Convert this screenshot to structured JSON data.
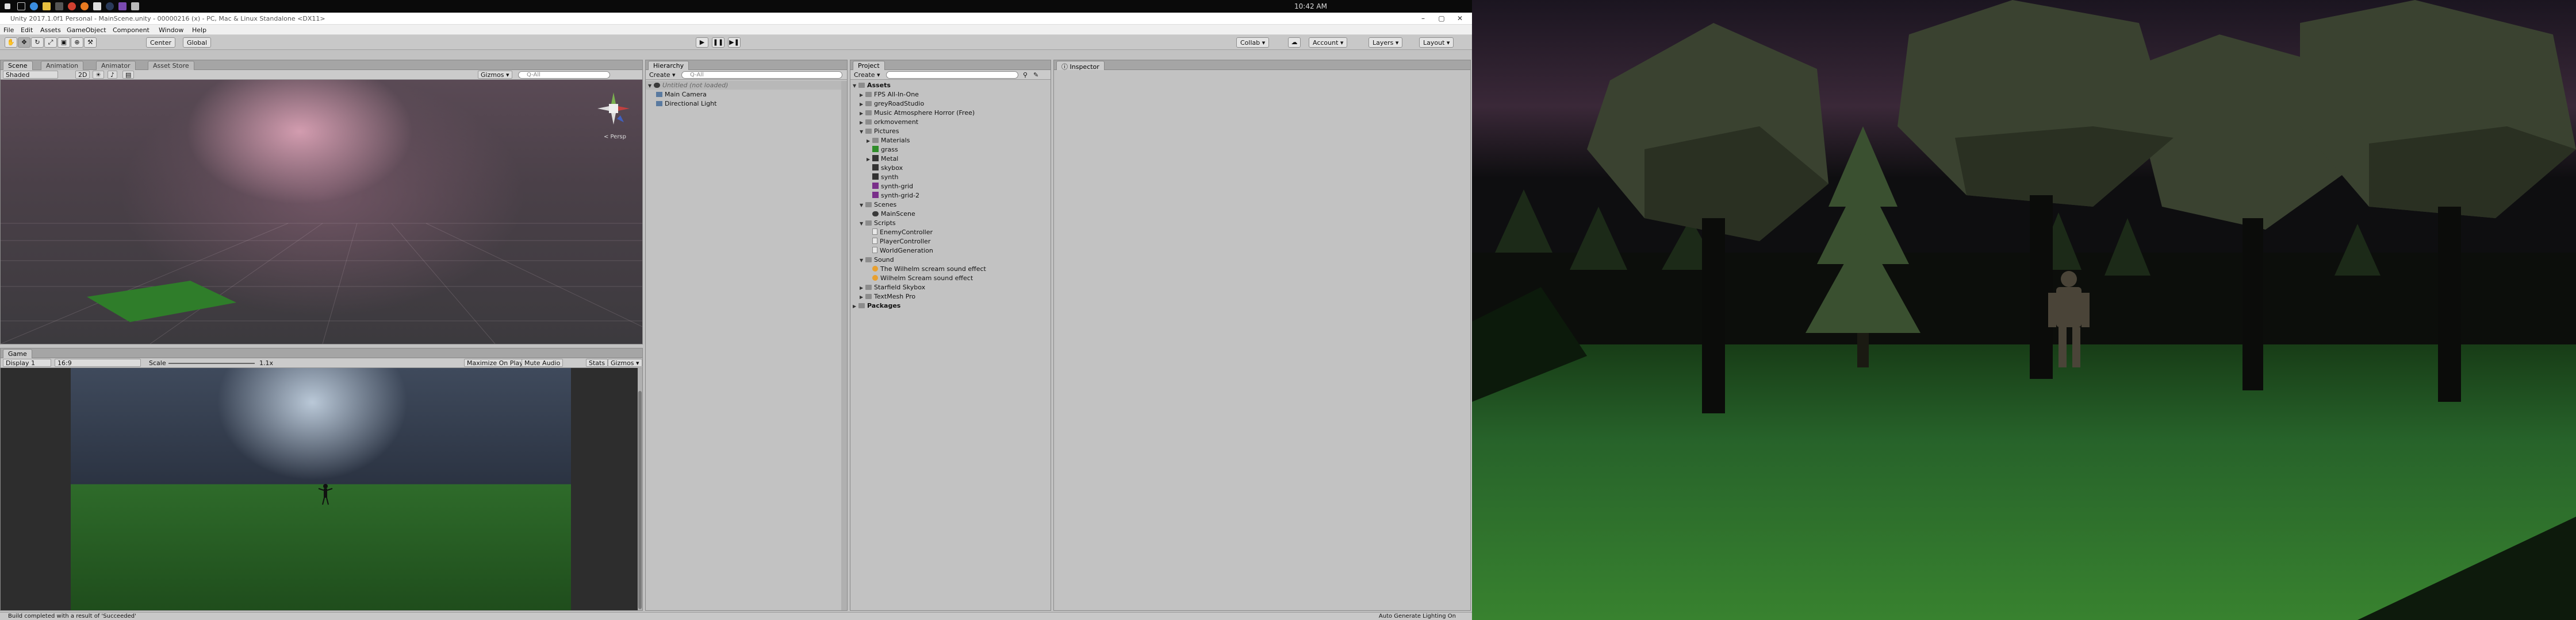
{
  "taskbar": {
    "clock": "10:42 AM",
    "icons": [
      "windows-icon",
      "task-view-icon",
      "edge-icon",
      "explorer-icon",
      "store-icon",
      "chrome-icon",
      "firefox-icon",
      "unity-icon",
      "steam-icon",
      "visual-studio-icon",
      "unity-hub-icon"
    ]
  },
  "unity": {
    "title": "Unity 2017.1.0f1 Personal - MainScene.unity - 00000216 (x) - PC, Mac & Linux Standalone <DX11>",
    "menus": [
      "File",
      "Edit",
      "Assets",
      "GameObject",
      "Component",
      "Window",
      "Help"
    ],
    "toolbar": {
      "center_label": "Center",
      "global_label": "Global",
      "collab_label": "Collab ▾",
      "account_label": "Account ▾",
      "layers_label": "Layers ▾",
      "layout_label": "Layout ▾"
    },
    "scene_panel": {
      "tabs": [
        "Scene",
        "Animation",
        "Animator",
        "Asset Store"
      ],
      "shading": "Shaded",
      "mode_2d": "2D",
      "gizmos": "Gizmos ▾",
      "search_placeholder": "Q-All",
      "persp_label": "< Persp"
    },
    "game_panel": {
      "tab": "Game",
      "display": "Display 1",
      "aspect": "16:9",
      "scale_label": "Scale",
      "scale_value": "1.1x",
      "buttons": [
        "Maximize On Play",
        "Mute Audio",
        "Stats",
        "Gizmos ▾"
      ]
    },
    "hierarchy": {
      "tab": "Hierarchy",
      "create": "Create ▾",
      "search_placeholder": "Q-All",
      "scene_name": "Untitled (not loaded)",
      "items": [
        "Main Camera",
        "Directional Light"
      ]
    },
    "project": {
      "tab": "Project",
      "create": "Create ▾",
      "root": "Assets",
      "rows": [
        {
          "label": "FPS All-In-One",
          "indent": 1,
          "icon": "folder",
          "arrow": "▶"
        },
        {
          "label": "greyRoadStudio",
          "indent": 1,
          "icon": "folder",
          "arrow": "▶"
        },
        {
          "label": "Music Atmosphere Horror (Free)",
          "indent": 1,
          "icon": "folder",
          "arrow": "▶"
        },
        {
          "label": "orkmovement",
          "indent": 1,
          "icon": "folder",
          "arrow": "▶"
        },
        {
          "label": "Pictures",
          "indent": 1,
          "icon": "folder",
          "arrow": "▼"
        },
        {
          "label": "Materials",
          "indent": 2,
          "icon": "folder",
          "arrow": "▶"
        },
        {
          "label": "grass",
          "indent": 2,
          "icon": "green",
          "arrow": ""
        },
        {
          "label": "Metal",
          "indent": 2,
          "icon": "mat",
          "arrow": "▶"
        },
        {
          "label": "skybox",
          "indent": 2,
          "icon": "mat",
          "arrow": ""
        },
        {
          "label": "synth",
          "indent": 2,
          "icon": "mat",
          "arrow": ""
        },
        {
          "label": "synth-grid",
          "indent": 2,
          "icon": "purple",
          "arrow": ""
        },
        {
          "label": "synth-grid-2",
          "indent": 2,
          "icon": "purple",
          "arrow": ""
        },
        {
          "label": "Scenes",
          "indent": 1,
          "icon": "folder",
          "arrow": "▼"
        },
        {
          "label": "MainScene",
          "indent": 2,
          "icon": "scene",
          "arrow": ""
        },
        {
          "label": "Scripts",
          "indent": 1,
          "icon": "folder",
          "arrow": "▼"
        },
        {
          "label": "EnemyController",
          "indent": 2,
          "icon": "script",
          "arrow": ""
        },
        {
          "label": "PlayerController",
          "indent": 2,
          "icon": "script",
          "arrow": ""
        },
        {
          "label": "WorldGeneration",
          "indent": 2,
          "icon": "script",
          "arrow": ""
        },
        {
          "label": "Sound",
          "indent": 1,
          "icon": "folder",
          "arrow": "▼"
        },
        {
          "label": "The Wilhelm scream sound effect",
          "indent": 2,
          "icon": "audio",
          "arrow": ""
        },
        {
          "label": "Wilhelm Scream sound effect",
          "indent": 2,
          "icon": "audio",
          "arrow": ""
        },
        {
          "label": "Starfield Skybox",
          "indent": 1,
          "icon": "folder",
          "arrow": "▶"
        },
        {
          "label": "TextMesh Pro",
          "indent": 1,
          "icon": "folder",
          "arrow": "▶"
        }
      ],
      "packages": "Packages"
    },
    "inspector": {
      "tab": "Inspector"
    },
    "status": {
      "message": "Build completed with a result of 'Succeeded'",
      "right": "Auto Generate Lighting On"
    }
  },
  "colors": {
    "unity_bg": "#c2c2c2",
    "grass": "#2f8d2a",
    "night_sky": "#1b1520"
  }
}
